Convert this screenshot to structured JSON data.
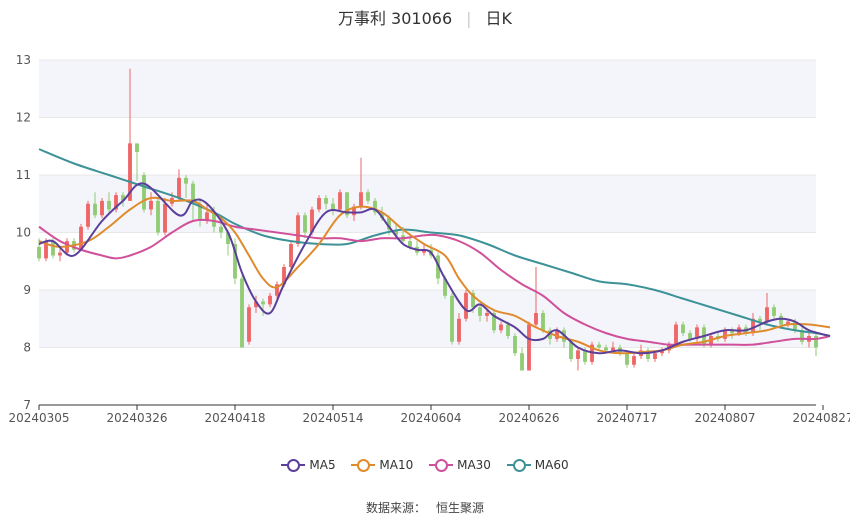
{
  "title": {
    "stock": "万事利 301066",
    "period": "日K"
  },
  "source": {
    "label": "数据来源：",
    "value": "恒生聚源"
  },
  "colors": {
    "up": "#ee6666",
    "down": "#91cc75",
    "ma5": "#5b3f9a",
    "ma10": "#e08a2e",
    "ma30": "#d0509a",
    "ma60": "#3c9296",
    "grid": "#e8e8e8",
    "band": "#f4f5fa",
    "axis": "#333333"
  },
  "chart_data": {
    "type": "candlestick",
    "y_ticks": [
      7,
      8,
      9,
      10,
      11,
      12,
      13
    ],
    "ylim": [
      7,
      13
    ],
    "x_tick_labels": [
      "20240305",
      "20240326",
      "20240418",
      "20240514",
      "20240604",
      "20240626",
      "20240717",
      "20240807",
      "20240827"
    ],
    "x_tick_index": [
      0,
      14,
      28,
      42,
      56,
      70,
      84,
      98,
      112
    ],
    "legend": [
      "MA5",
      "MA10",
      "MA30",
      "MA60"
    ],
    "candles": [
      [
        9.75,
        9.55,
        9.9,
        9.5
      ],
      [
        9.55,
        9.85,
        9.9,
        9.5
      ],
      [
        9.85,
        9.6,
        9.9,
        9.55
      ],
      [
        9.6,
        9.65,
        9.75,
        9.5
      ],
      [
        9.65,
        9.85,
        9.9,
        9.6
      ],
      [
        9.85,
        9.7,
        9.9,
        9.65
      ],
      [
        9.7,
        10.1,
        10.15,
        9.7
      ],
      [
        10.1,
        10.5,
        10.55,
        10.05
      ],
      [
        10.5,
        10.3,
        10.7,
        10.25
      ],
      [
        10.3,
        10.55,
        10.6,
        10.25
      ],
      [
        10.55,
        10.4,
        10.7,
        10.35
      ],
      [
        10.4,
        10.65,
        10.7,
        10.35
      ],
      [
        10.65,
        10.55,
        10.7,
        10.45
      ],
      [
        10.55,
        11.55,
        12.85,
        10.55
      ],
      [
        11.55,
        11.4,
        11.5,
        10.9
      ],
      [
        11.0,
        10.4,
        11.05,
        10.35
      ],
      [
        10.4,
        10.55,
        10.7,
        10.3
      ],
      [
        10.55,
        10.0,
        10.6,
        9.95
      ],
      [
        10.0,
        10.5,
        10.6,
        9.95
      ],
      [
        10.5,
        10.6,
        10.7,
        10.45
      ],
      [
        10.6,
        10.95,
        11.1,
        10.55
      ],
      [
        10.95,
        10.85,
        11.0,
        10.6
      ],
      [
        10.85,
        10.5,
        10.9,
        10.2
      ],
      [
        10.5,
        10.2,
        10.6,
        10.1
      ],
      [
        10.2,
        10.35,
        10.5,
        10.15
      ],
      [
        10.35,
        10.1,
        10.45,
        10.0
      ],
      [
        10.1,
        10.0,
        10.2,
        9.9
      ],
      [
        10.0,
        9.8,
        10.05,
        9.6
      ],
      [
        9.8,
        9.2,
        9.9,
        9.1
      ],
      [
        9.2,
        8.0,
        9.25,
        8.0
      ],
      [
        8.1,
        8.7,
        8.75,
        8.05
      ],
      [
        8.7,
        8.8,
        8.9,
        8.6
      ],
      [
        8.8,
        8.75,
        8.85,
        8.55
      ],
      [
        8.75,
        8.9,
        8.95,
        8.7
      ],
      [
        8.9,
        9.1,
        9.15,
        8.85
      ],
      [
        9.1,
        9.4,
        9.45,
        9.05
      ],
      [
        9.4,
        9.8,
        9.85,
        9.35
      ],
      [
        9.8,
        10.3,
        10.35,
        9.75
      ],
      [
        10.3,
        10.0,
        10.35,
        9.9
      ],
      [
        10.0,
        10.4,
        10.45,
        9.95
      ],
      [
        10.4,
        10.6,
        10.65,
        10.35
      ],
      [
        10.6,
        10.5,
        10.65,
        10.4
      ],
      [
        10.5,
        10.4,
        10.6,
        10.3
      ],
      [
        10.4,
        10.7,
        10.75,
        10.35
      ],
      [
        10.7,
        10.3,
        10.7,
        10.25
      ],
      [
        10.3,
        10.45,
        10.5,
        10.2
      ],
      [
        10.45,
        10.7,
        11.3,
        10.4
      ],
      [
        10.7,
        10.55,
        10.75,
        10.5
      ],
      [
        10.55,
        10.35,
        10.6,
        10.3
      ],
      [
        10.35,
        10.25,
        10.45,
        10.2
      ],
      [
        10.25,
        10.05,
        10.3,
        9.95
      ],
      [
        10.05,
        9.95,
        10.15,
        9.9
      ],
      [
        9.95,
        9.85,
        10.1,
        9.8
      ],
      [
        9.85,
        9.75,
        9.95,
        9.7
      ],
      [
        9.75,
        9.65,
        9.85,
        9.6
      ],
      [
        9.65,
        9.7,
        9.8,
        9.6
      ],
      [
        9.7,
        9.6,
        9.8,
        9.55
      ],
      [
        9.6,
        9.2,
        9.65,
        9.1
      ],
      [
        9.2,
        8.9,
        9.25,
        8.85
      ],
      [
        8.9,
        8.1,
        8.95,
        8.05
      ],
      [
        8.1,
        8.5,
        8.6,
        8.05
      ],
      [
        8.5,
        8.95,
        9.0,
        8.45
      ],
      [
        8.95,
        8.7,
        9.0,
        8.6
      ],
      [
        8.7,
        8.55,
        8.75,
        8.45
      ],
      [
        8.55,
        8.6,
        8.65,
        8.45
      ],
      [
        8.6,
        8.3,
        8.65,
        8.25
      ],
      [
        8.3,
        8.4,
        8.45,
        8.25
      ],
      [
        8.4,
        8.2,
        8.45,
        8.15
      ],
      [
        8.2,
        7.9,
        8.25,
        7.85
      ],
      [
        7.9,
        7.6,
        8.0,
        7.6
      ],
      [
        7.6,
        8.4,
        8.45,
        7.6
      ],
      [
        8.4,
        8.6,
        9.4,
        8.35
      ],
      [
        8.6,
        8.3,
        8.65,
        8.25
      ],
      [
        8.3,
        8.15,
        8.35,
        8.05
      ],
      [
        8.15,
        8.3,
        8.35,
        8.1
      ],
      [
        8.3,
        8.1,
        8.35,
        8.0
      ],
      [
        8.1,
        7.8,
        8.15,
        7.75
      ],
      [
        7.8,
        7.95,
        8.0,
        7.6
      ],
      [
        7.95,
        7.75,
        8.0,
        7.7
      ],
      [
        7.75,
        8.05,
        8.1,
        7.7
      ],
      [
        8.05,
        8.0,
        8.1,
        7.95
      ],
      [
        8.0,
        7.95,
        8.05,
        7.9
      ],
      [
        7.95,
        8.0,
        8.1,
        7.9
      ],
      [
        8.0,
        7.9,
        8.05,
        7.85
      ],
      [
        7.9,
        7.7,
        7.95,
        7.65
      ],
      [
        7.7,
        7.85,
        7.9,
        7.65
      ],
      [
        7.85,
        7.95,
        8.05,
        7.8
      ],
      [
        7.95,
        7.8,
        8.0,
        7.75
      ],
      [
        7.8,
        7.9,
        7.95,
        7.75
      ],
      [
        7.9,
        7.95,
        8.0,
        7.85
      ],
      [
        7.95,
        8.05,
        8.1,
        7.9
      ],
      [
        8.05,
        8.4,
        8.45,
        8.0
      ],
      [
        8.4,
        8.25,
        8.45,
        8.2
      ],
      [
        8.25,
        8.15,
        8.3,
        8.1
      ],
      [
        8.15,
        8.35,
        8.4,
        8.1
      ],
      [
        8.35,
        8.05,
        8.4,
        8.0
      ],
      [
        8.05,
        8.2,
        8.25,
        8.0
      ],
      [
        8.2,
        8.15,
        8.25,
        8.1
      ],
      [
        8.15,
        8.3,
        8.35,
        8.1
      ],
      [
        8.3,
        8.25,
        8.35,
        8.15
      ],
      [
        8.25,
        8.35,
        8.4,
        8.2
      ],
      [
        8.35,
        8.25,
        8.4,
        8.2
      ],
      [
        8.25,
        8.5,
        8.6,
        8.2
      ],
      [
        8.5,
        8.45,
        8.55,
        8.3
      ],
      [
        8.45,
        8.7,
        8.95,
        8.4
      ],
      [
        8.7,
        8.55,
        8.75,
        8.5
      ],
      [
        8.55,
        8.4,
        8.6,
        8.35
      ],
      [
        8.4,
        8.45,
        8.5,
        8.35
      ],
      [
        8.45,
        8.3,
        8.5,
        8.25
      ],
      [
        8.3,
        8.1,
        8.35,
        8.05
      ],
      [
        8.1,
        8.2,
        8.25,
        8.0
      ],
      [
        8.2,
        8.0,
        8.25,
        7.85
      ]
    ],
    "ma5_anchors": [
      [
        0,
        9.8
      ],
      [
        2,
        9.85
      ],
      [
        5,
        9.6
      ],
      [
        9,
        10.2
      ],
      [
        12,
        10.55
      ],
      [
        15,
        10.85
      ],
      [
        20,
        10.3
      ],
      [
        22,
        10.55
      ],
      [
        24,
        10.5
      ],
      [
        27,
        10.0
      ],
      [
        29,
        9.3
      ],
      [
        31,
        8.8
      ],
      [
        33,
        8.6
      ],
      [
        35,
        9.1
      ],
      [
        38,
        9.8
      ],
      [
        41,
        10.35
      ],
      [
        44,
        10.35
      ],
      [
        46,
        10.35
      ],
      [
        48,
        10.4
      ],
      [
        50,
        10.1
      ],
      [
        52,
        9.8
      ],
      [
        54,
        9.7
      ],
      [
        56,
        9.65
      ],
      [
        58,
        9.2
      ],
      [
        61,
        8.65
      ],
      [
        63,
        8.75
      ],
      [
        65,
        8.55
      ],
      [
        68,
        8.35
      ],
      [
        70,
        8.15
      ],
      [
        72,
        8.15
      ],
      [
        74,
        8.3
      ],
      [
        77,
        8.0
      ],
      [
        80,
        7.9
      ],
      [
        83,
        7.95
      ],
      [
        86,
        7.9
      ],
      [
        89,
        7.95
      ],
      [
        92,
        8.1
      ],
      [
        95,
        8.2
      ],
      [
        98,
        8.3
      ],
      [
        101,
        8.3
      ],
      [
        104,
        8.45
      ],
      [
        106,
        8.5
      ],
      [
        108,
        8.45
      ],
      [
        110,
        8.3
      ],
      [
        113,
        8.2
      ]
    ],
    "ma10_anchors": [
      [
        0,
        9.85
      ],
      [
        3,
        9.75
      ],
      [
        7,
        9.85
      ],
      [
        10,
        10.1
      ],
      [
        13,
        10.4
      ],
      [
        16,
        10.6
      ],
      [
        19,
        10.55
      ],
      [
        22,
        10.55
      ],
      [
        24,
        10.4
      ],
      [
        26,
        10.25
      ],
      [
        28,
        10.0
      ],
      [
        30,
        9.6
      ],
      [
        32,
        9.2
      ],
      [
        34,
        9.05
      ],
      [
        37,
        9.4
      ],
      [
        40,
        9.8
      ],
      [
        43,
        10.3
      ],
      [
        46,
        10.45
      ],
      [
        49,
        10.35
      ],
      [
        52,
        10.05
      ],
      [
        55,
        9.8
      ],
      [
        58,
        9.6
      ],
      [
        60,
        9.2
      ],
      [
        62,
        8.9
      ],
      [
        65,
        8.65
      ],
      [
        68,
        8.55
      ],
      [
        71,
        8.35
      ],
      [
        74,
        8.2
      ],
      [
        77,
        8.1
      ],
      [
        80,
        7.95
      ],
      [
        83,
        7.9
      ],
      [
        86,
        7.92
      ],
      [
        89,
        7.95
      ],
      [
        92,
        8.05
      ],
      [
        95,
        8.1
      ],
      [
        98,
        8.2
      ],
      [
        101,
        8.25
      ],
      [
        104,
        8.3
      ],
      [
        107,
        8.4
      ],
      [
        110,
        8.4
      ],
      [
        113,
        8.35
      ]
    ],
    "ma30_anchors": [
      [
        0,
        10.1
      ],
      [
        3,
        9.85
      ],
      [
        6,
        9.7
      ],
      [
        9,
        9.6
      ],
      [
        11,
        9.55
      ],
      [
        13,
        9.6
      ],
      [
        16,
        9.75
      ],
      [
        19,
        10.0
      ],
      [
        22,
        10.2
      ],
      [
        25,
        10.2
      ],
      [
        28,
        10.1
      ],
      [
        31,
        10.05
      ],
      [
        34,
        10.0
      ],
      [
        37,
        9.95
      ],
      [
        40,
        9.9
      ],
      [
        43,
        9.9
      ],
      [
        46,
        9.85
      ],
      [
        49,
        9.9
      ],
      [
        52,
        9.9
      ],
      [
        55,
        9.95
      ],
      [
        57,
        9.95
      ],
      [
        60,
        9.85
      ],
      [
        63,
        9.65
      ],
      [
        66,
        9.35
      ],
      [
        69,
        9.1
      ],
      [
        72,
        8.9
      ],
      [
        75,
        8.6
      ],
      [
        78,
        8.4
      ],
      [
        81,
        8.25
      ],
      [
        84,
        8.15
      ],
      [
        87,
        8.1
      ],
      [
        90,
        8.05
      ],
      [
        93,
        8.05
      ],
      [
        96,
        8.05
      ],
      [
        99,
        8.05
      ],
      [
        102,
        8.05
      ],
      [
        105,
        8.1
      ],
      [
        108,
        8.15
      ],
      [
        111,
        8.15
      ],
      [
        113,
        8.2
      ]
    ],
    "ma60_anchors": [
      [
        0,
        11.45
      ],
      [
        5,
        11.2
      ],
      [
        10,
        11.0
      ],
      [
        15,
        10.8
      ],
      [
        20,
        10.6
      ],
      [
        25,
        10.35
      ],
      [
        28,
        10.15
      ],
      [
        32,
        9.95
      ],
      [
        36,
        9.85
      ],
      [
        40,
        9.8
      ],
      [
        44,
        9.8
      ],
      [
        48,
        9.95
      ],
      [
        52,
        10.05
      ],
      [
        56,
        10.0
      ],
      [
        60,
        9.95
      ],
      [
        64,
        9.8
      ],
      [
        68,
        9.6
      ],
      [
        72,
        9.45
      ],
      [
        76,
        9.3
      ],
      [
        80,
        9.15
      ],
      [
        84,
        9.1
      ],
      [
        88,
        9.0
      ],
      [
        92,
        8.85
      ],
      [
        96,
        8.7
      ],
      [
        100,
        8.55
      ],
      [
        104,
        8.4
      ],
      [
        108,
        8.3
      ],
      [
        111,
        8.25
      ],
      [
        113,
        8.2
      ]
    ]
  }
}
